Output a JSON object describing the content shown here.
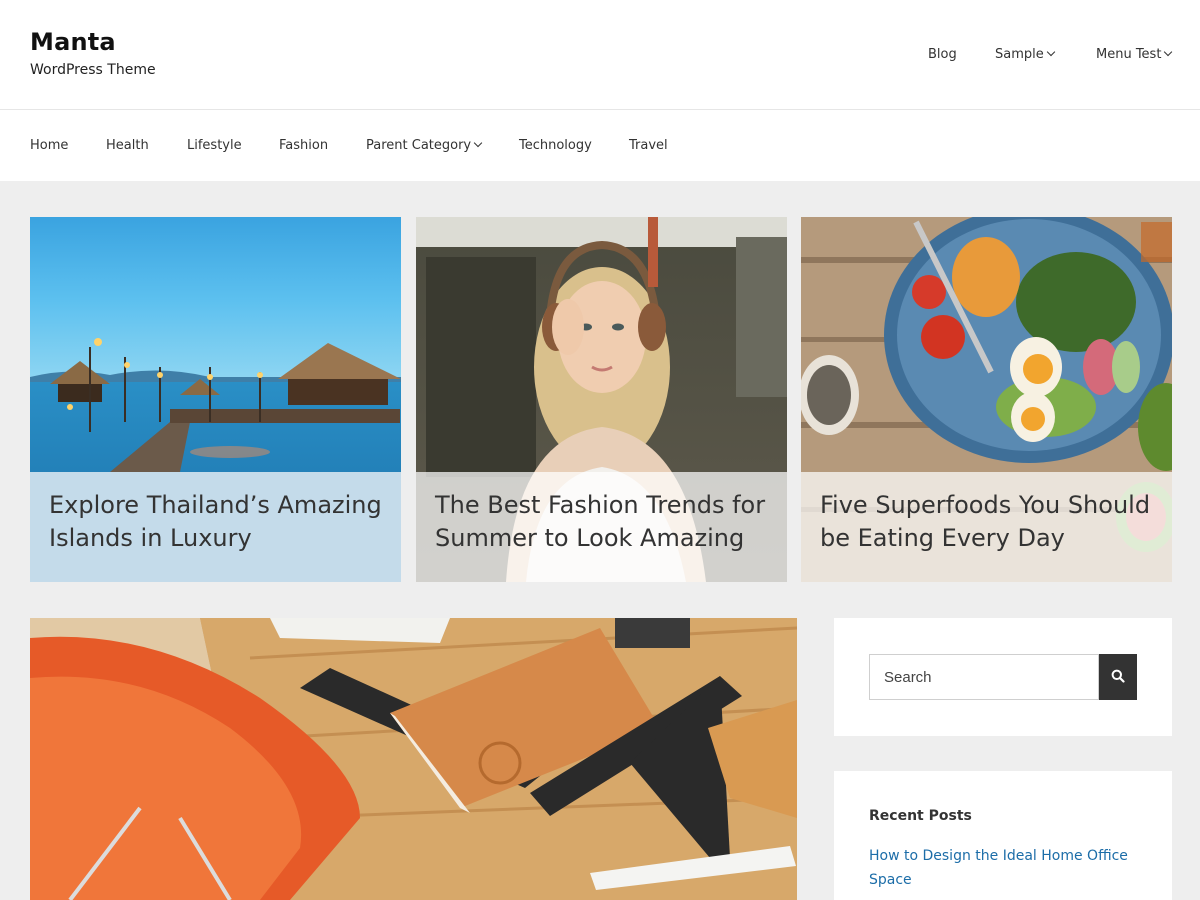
{
  "site": {
    "title": "Manta",
    "description": "WordPress Theme"
  },
  "top_nav": {
    "items": [
      {
        "label": "Blog",
        "has_dropdown": false
      },
      {
        "label": "Sample",
        "has_dropdown": true
      },
      {
        "label": "Menu Test",
        "has_dropdown": true
      }
    ]
  },
  "category_nav": {
    "items": [
      {
        "label": "Home",
        "has_dropdown": false
      },
      {
        "label": "Health",
        "has_dropdown": false
      },
      {
        "label": "Lifestyle",
        "has_dropdown": false
      },
      {
        "label": "Fashion",
        "has_dropdown": false
      },
      {
        "label": "Parent Category",
        "has_dropdown": true
      },
      {
        "label": "Technology",
        "has_dropdown": false
      },
      {
        "label": "Travel",
        "has_dropdown": false
      }
    ]
  },
  "featured_posts": [
    {
      "title": "Explore Thailand’s Amazing Islands in Luxury",
      "image": "tropical-pier-photo"
    },
    {
      "title": "The Best Fashion Trends for Summer to Look Amazing",
      "image": "woman-headphones-photo"
    },
    {
      "title": "Five Superfoods You Should be Eating Every Day",
      "image": "salad-bowl-photo"
    }
  ],
  "main_post": {
    "image": "office-desk-photo"
  },
  "sidebar": {
    "search": {
      "placeholder": "Search",
      "button_icon": "search-icon"
    },
    "recent_posts": {
      "title": "Recent Posts",
      "items": [
        "How to Design the Ideal Home Office Space"
      ]
    }
  },
  "colors": {
    "link": "#1c6da8",
    "background": "#eeeeee",
    "search_button": "#333333"
  }
}
